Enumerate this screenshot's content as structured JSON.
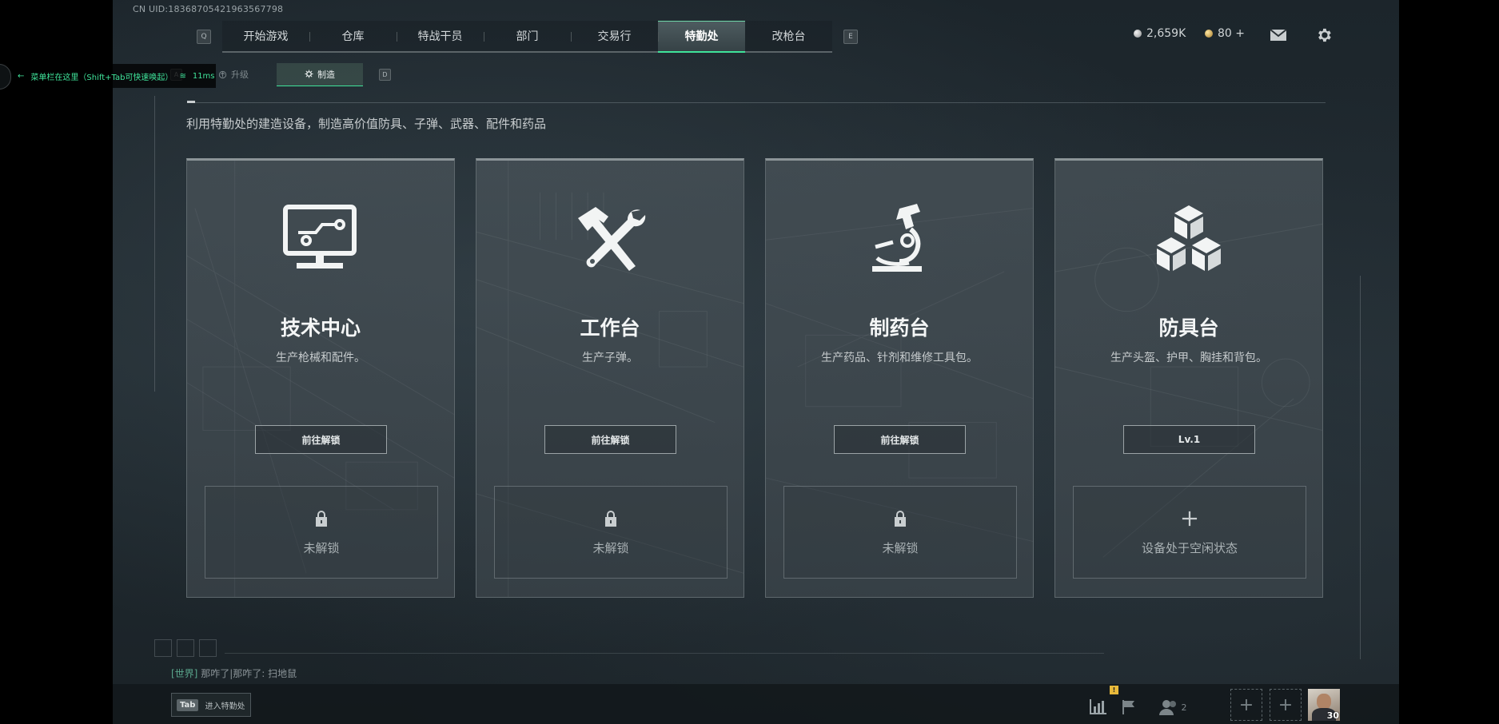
{
  "uid": "CN UID:1836870542196356​7798",
  "nav": {
    "key_prev": "Q",
    "key_next": "E",
    "tabs": [
      {
        "label": "开始游戏"
      },
      {
        "label": "仓库"
      },
      {
        "label": "特战干员"
      },
      {
        "label": "部门"
      },
      {
        "label": "交易行"
      },
      {
        "label": "特勤处",
        "active": true
      },
      {
        "label": "改枪台"
      }
    ]
  },
  "currency": {
    "silver": "2,659K",
    "gold": "80 +"
  },
  "subnav": {
    "key_prev": "A",
    "key_next": "D",
    "tabs": [
      {
        "label": "升级"
      },
      {
        "label": "制造",
        "active": true
      }
    ]
  },
  "overlay_tip": {
    "text": "菜单栏在这里（Shift+Tab可快速唤起）",
    "ping": "11ms"
  },
  "description": "利用特勤处的建造设备，制造高价值防具、子弹、武器、配件和药品",
  "cards": [
    {
      "icon": "monitor-icon",
      "title": "技术中心",
      "subtitle": "生产枪械和配件。",
      "button": "前往解锁",
      "slot_text": "未解锁",
      "slot_icon": "lock-icon"
    },
    {
      "icon": "hammer-wrench-icon",
      "title": "工作台",
      "subtitle": "生产子弹。",
      "button": "前往解锁",
      "slot_text": "未解锁",
      "slot_icon": "lock-icon"
    },
    {
      "icon": "microscope-icon",
      "title": "制药台",
      "subtitle": "生产药品、针剂和维修工具包。",
      "button": "前往解锁",
      "slot_text": "未解锁",
      "slot_icon": "lock-icon"
    },
    {
      "icon": "cubes-icon",
      "title": "防具台",
      "subtitle": "生产头盔、护甲、胸挂和背包。",
      "button": "Lv.1",
      "slot_text": "设备处于空闲状态",
      "slot_icon": "plus-icon"
    }
  ],
  "chat": {
    "channel": "[世界]",
    "message": "那咋了|那咋了: 扫地鼠"
  },
  "bottom": {
    "tab_key": "Tab",
    "tab_label": "进入特勤处",
    "squad_count": "2",
    "notice_badge": "!",
    "avatar_level": "30"
  },
  "colors": {
    "accent": "#3fe39a",
    "card_bg": "#4a545a",
    "background": "#1f282e"
  }
}
